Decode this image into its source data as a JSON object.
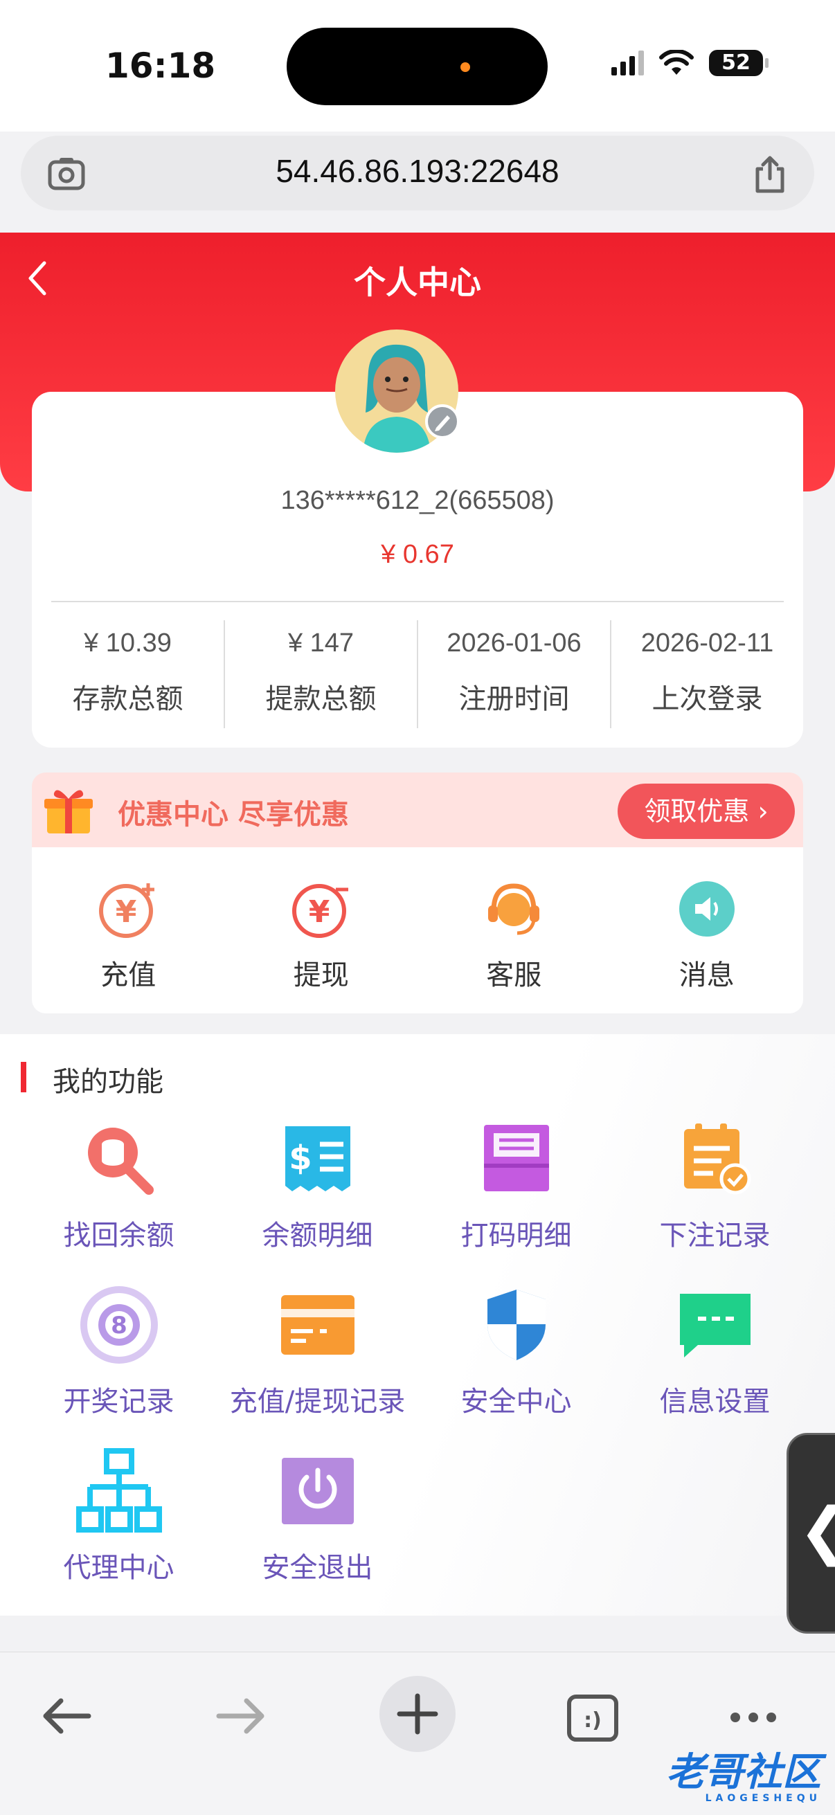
{
  "status_bar": {
    "time": "16:18",
    "battery": "52"
  },
  "browser": {
    "url": "54.46.86.193:22648"
  },
  "header": {
    "title": "个人中心"
  },
  "profile": {
    "username": "136*****612_2(665508)",
    "balance": "¥ 0.67",
    "stats": [
      {
        "value": "¥ 10.39",
        "label": "存款总额"
      },
      {
        "value": "¥ 147",
        "label": "提款总额"
      },
      {
        "value": "2026-01-06",
        "label": "注册时间"
      },
      {
        "value": "2026-02-11",
        "label": "上次登录"
      }
    ]
  },
  "promo": {
    "text": "优惠中心 尽享优惠",
    "button": "领取优惠 ›"
  },
  "quick_actions": [
    {
      "label": "充值",
      "icon": "recharge-icon"
    },
    {
      "label": "提现",
      "icon": "withdraw-icon"
    },
    {
      "label": "客服",
      "icon": "customer-service-icon"
    },
    {
      "label": "消息",
      "icon": "message-icon"
    }
  ],
  "functions": {
    "title": "我的功能",
    "items": [
      {
        "label": "找回余额",
        "icon": "recover-balance-icon"
      },
      {
        "label": "余额明细",
        "icon": "balance-detail-icon"
      },
      {
        "label": "打码明细",
        "icon": "betting-detail-icon"
      },
      {
        "label": "下注记录",
        "icon": "bet-record-icon"
      },
      {
        "label": "开奖记录",
        "icon": "lottery-record-icon"
      },
      {
        "label": "充值/提现记录",
        "icon": "transaction-record-icon"
      },
      {
        "label": "安全中心",
        "icon": "security-shield-icon"
      },
      {
        "label": "信息设置",
        "icon": "info-settings-icon"
      },
      {
        "label": "代理中心",
        "icon": "agent-hierarchy-icon"
      },
      {
        "label": "安全退出",
        "icon": "logout-power-icon"
      }
    ]
  },
  "side_tab": {
    "label": "❮"
  },
  "watermark": {
    "text": "老哥社区",
    "sub": "LAOGESHEQU"
  }
}
